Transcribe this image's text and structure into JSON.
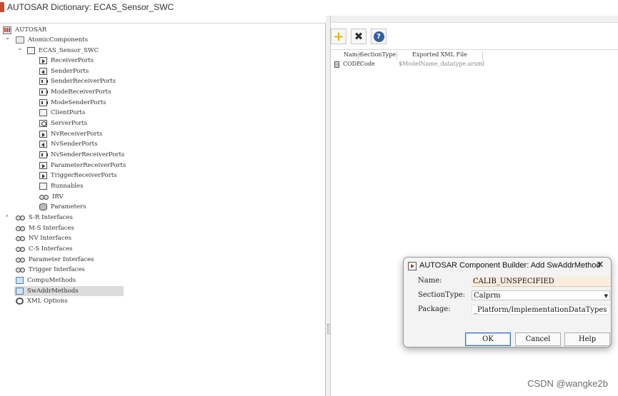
{
  "window": {
    "title": "AUTOSAR Dictionary: ECAS_Sensor_SWC"
  },
  "tree": {
    "root": "AUTOSAR",
    "atomic_components": "AtomicComponents",
    "component": "ECAS_Sensor_SWC",
    "component_children": [
      {
        "label": "ReceiverPorts",
        "icon": "port-in-icon"
      },
      {
        "label": "SenderPorts",
        "icon": "port-out-icon"
      },
      {
        "label": "SenderReceiverPorts",
        "icon": "port-sr-icon"
      },
      {
        "label": "ModeReceiverPorts",
        "icon": "mode-port-icon"
      },
      {
        "label": "ModeSenderPorts",
        "icon": "mode-port-icon"
      },
      {
        "label": "ClientPorts",
        "icon": "client-port-icon"
      },
      {
        "label": "ServerPorts",
        "icon": "server-port-icon"
      },
      {
        "label": "NvReceiverPorts",
        "icon": "nv-port-in-icon"
      },
      {
        "label": "NvSenderPorts",
        "icon": "nv-port-out-icon"
      },
      {
        "label": "NvSenderReceiverPorts",
        "icon": "nv-port-sr-icon"
      },
      {
        "label": "ParameterReceiverPorts",
        "icon": "param-port-icon"
      },
      {
        "label": "TriggerReceiverPorts",
        "icon": "trigger-port-icon"
      },
      {
        "label": "Runnables",
        "icon": "runnable-icon"
      },
      {
        "label": "IRV",
        "icon": "irv-icon"
      },
      {
        "label": "Parameters",
        "icon": "database-icon"
      }
    ],
    "top_level": [
      {
        "label": "S-R Interfaces",
        "icon": "interface-icon"
      },
      {
        "label": "M-S Interfaces",
        "icon": "interface-icon"
      },
      {
        "label": "NV Interfaces",
        "icon": "interface-icon"
      },
      {
        "label": "C-S Interfaces",
        "icon": "interface-icon"
      },
      {
        "label": "Parameter Interfaces",
        "icon": "interface-icon"
      },
      {
        "label": "Trigger Interfaces",
        "icon": "interface-icon"
      },
      {
        "label": "CompuMethods",
        "icon": "folder-icon"
      },
      {
        "label": "SwAddrMethods",
        "icon": "folder-icon"
      },
      {
        "label": "XML Options",
        "icon": "gear-icon"
      }
    ],
    "selected": "SwAddrMethods"
  },
  "right_panel": {
    "toolbar": {
      "add": "+",
      "delete": "✖",
      "help": "?"
    },
    "table": {
      "columns": [
        "Name",
        "SectionType",
        "Exported XML File"
      ],
      "rows": [
        {
          "name": "CODE",
          "section_type": "Code",
          "file": "$ModelName_datatype.arxml"
        }
      ]
    }
  },
  "dialog": {
    "title": "AUTOSAR Component Builder: Add SwAddrMethod",
    "close": "✕",
    "name_label": "Name:",
    "name_value": "CALIB_UNSPECIFIED",
    "section_type_label": "SectionType:",
    "section_type_value": "Calprm",
    "package_label": "Package:",
    "package_value": "_Platform/ImplementationDataTypes",
    "ok": "OK",
    "cancel": "Cancel",
    "help": "Help",
    "colors": {
      "name_field_bg": "#fbecdc",
      "ok_border": "#2f6fbf"
    }
  },
  "watermark": "CSDN @wangke2b"
}
